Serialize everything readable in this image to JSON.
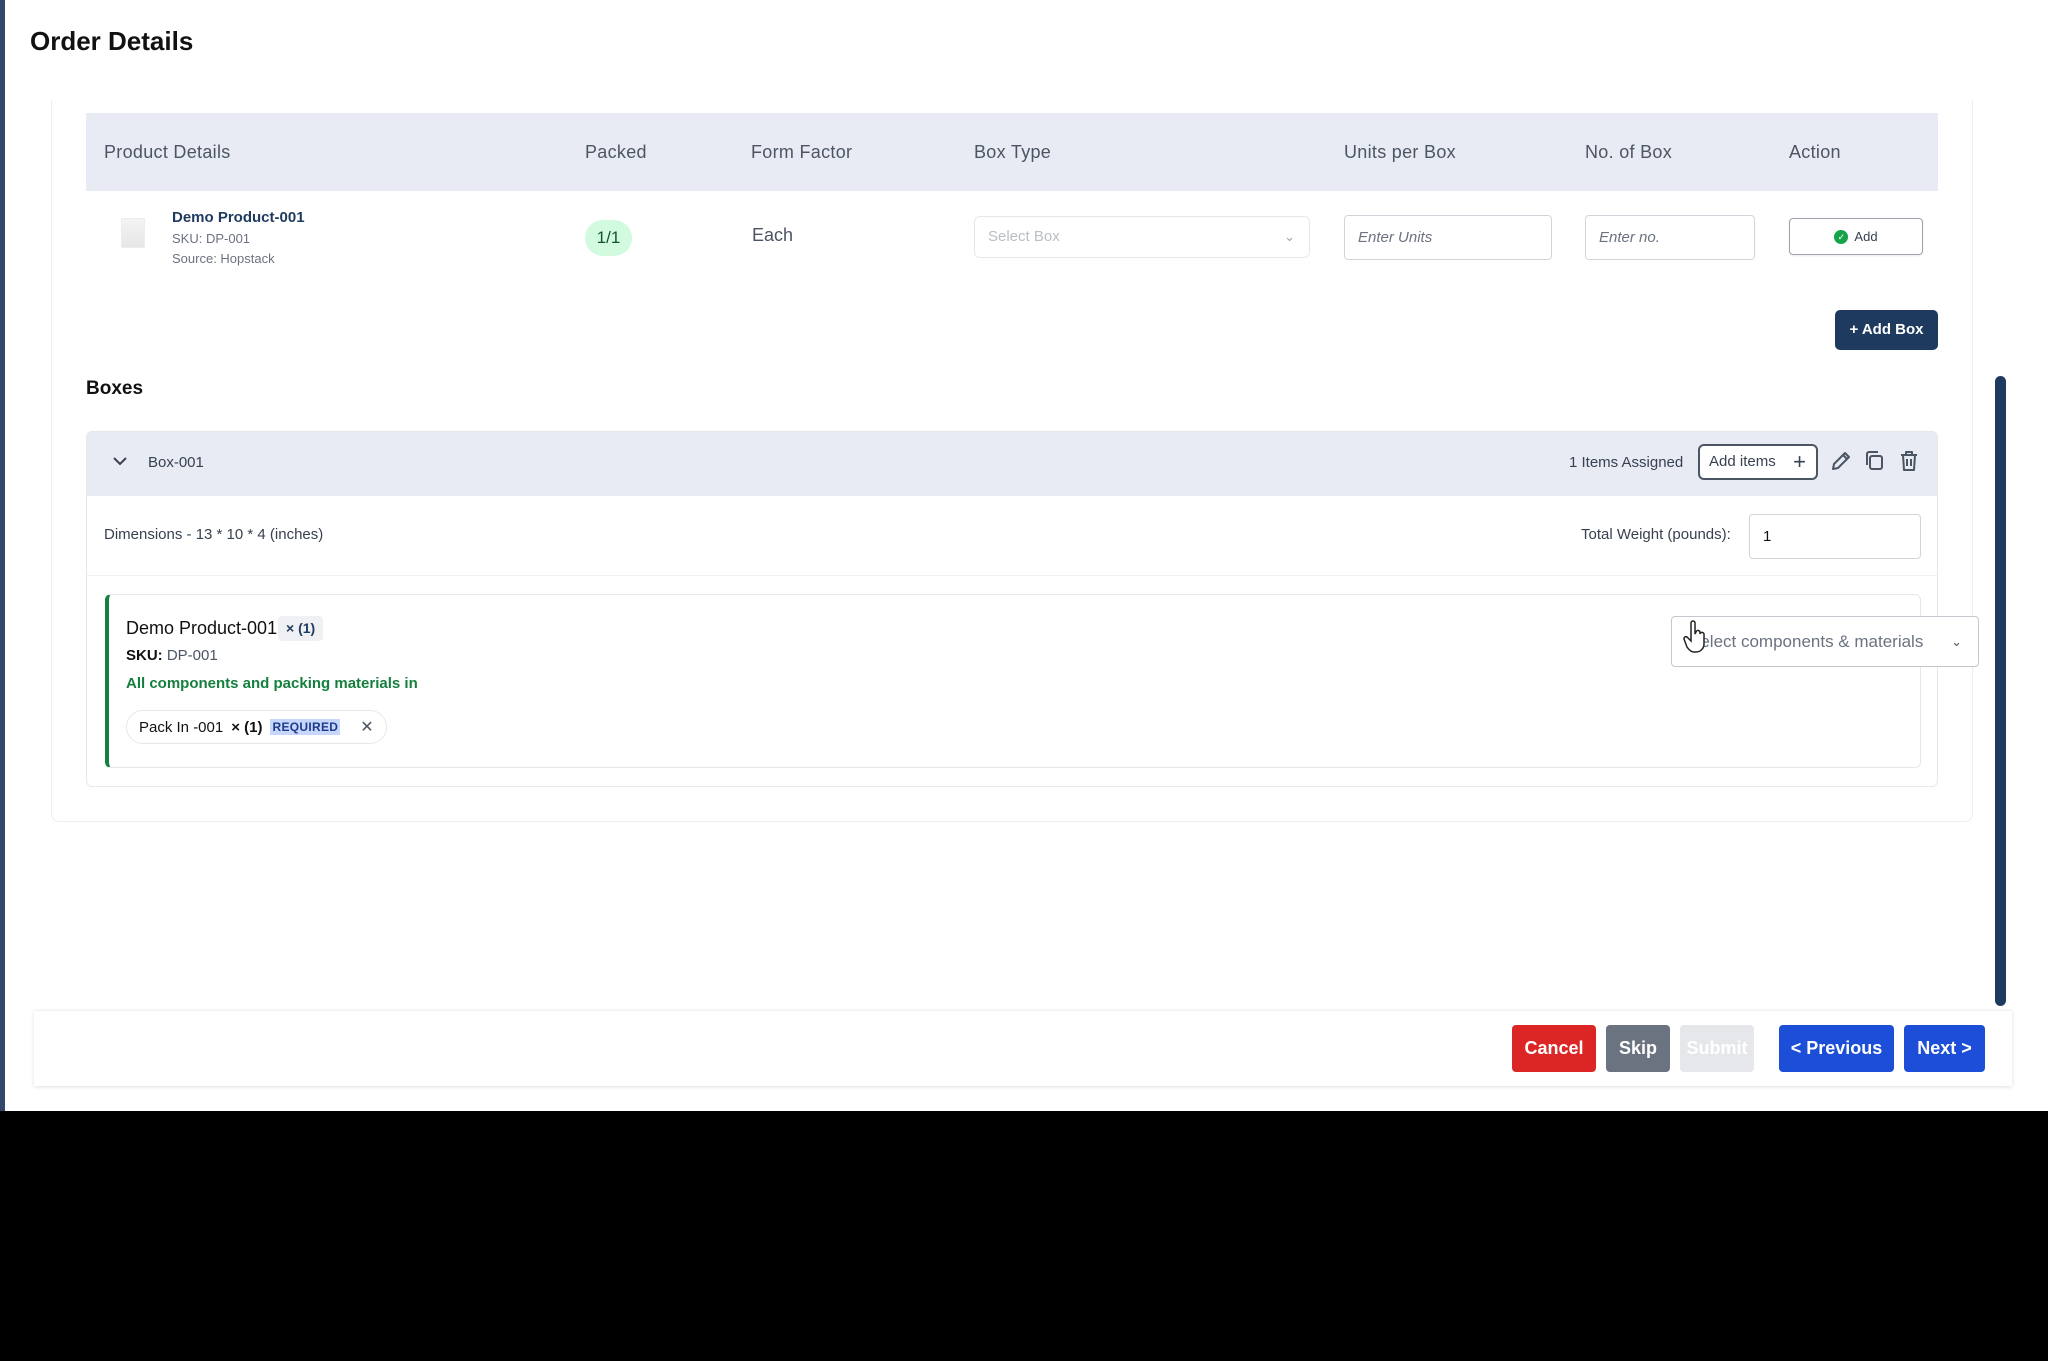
{
  "page": {
    "title": "Order Details"
  },
  "table": {
    "headers": [
      "Product Details",
      "Packed",
      "Form Factor",
      "Box Type",
      "Units per Box",
      "No. of Box",
      "Action"
    ],
    "row": {
      "name": "Demo Product-001",
      "sku": "SKU: DP-001",
      "source": "Source: Hopstack",
      "packed": "1/1",
      "form_factor": "Each",
      "box_type_placeholder": "Select Box",
      "units_placeholder": "Enter Units",
      "boxes_placeholder": "Enter no.",
      "action_label": "Add"
    },
    "add_box_label": "+ Add Box"
  },
  "boxes": {
    "title": "Boxes",
    "box": {
      "name": "Box-001",
      "items_assigned": "1 Items Assigned",
      "add_items_label": "Add items",
      "dimensions": "Dimensions - 13 * 10 * 4 (inches)",
      "weight_label": "Total Weight (pounds):",
      "weight_value": "1",
      "item": {
        "name": "Demo Product-001",
        "qty": "× (1)",
        "sku_label": "SKU:",
        "sku_value": "DP-001",
        "status": "All components and packing materials in",
        "chip_name": "Pack In -001",
        "chip_qty": "× (1)",
        "chip_tag": "REQUIRED",
        "components_placeholder": "Select components & materials"
      }
    }
  },
  "footer": {
    "cancel": "Cancel",
    "skip": "Skip",
    "submit": "Submit",
    "previous": "< Previous",
    "next": "Next >"
  },
  "colors": {
    "primary_dark": "#1e3a5f",
    "cancel": "#dc2626",
    "skip": "#6b7280",
    "submit_disabled": "#e5e7eb",
    "nav_blue": "#1d4ed8",
    "success": "#15803d"
  }
}
